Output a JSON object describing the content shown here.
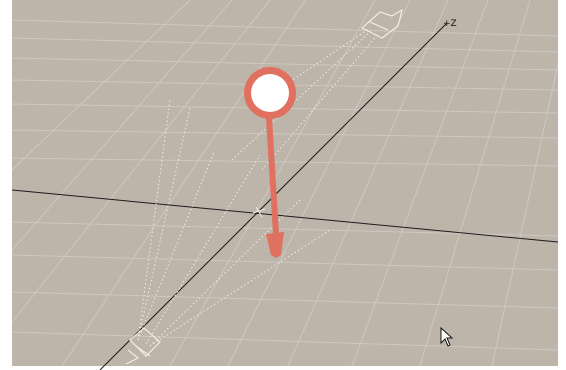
{
  "viewport": {
    "view": "perspective",
    "floor_color": "#bdb4aa",
    "grid_line_color": "#cfc8bf",
    "axis_color": "#1c1c1c",
    "ui_border_color": "#ffffff"
  },
  "axis": {
    "z_label": "+Z"
  },
  "light": {
    "type": "spotlight",
    "icon": "spotlight-icon",
    "selected_color": "#e0705f",
    "center_color": "#ffffff"
  },
  "cameras": {
    "icon": "camera-icon",
    "frustum_color": "#f2ede3"
  },
  "cursor": {
    "icon": "mouse-pointer-icon"
  }
}
